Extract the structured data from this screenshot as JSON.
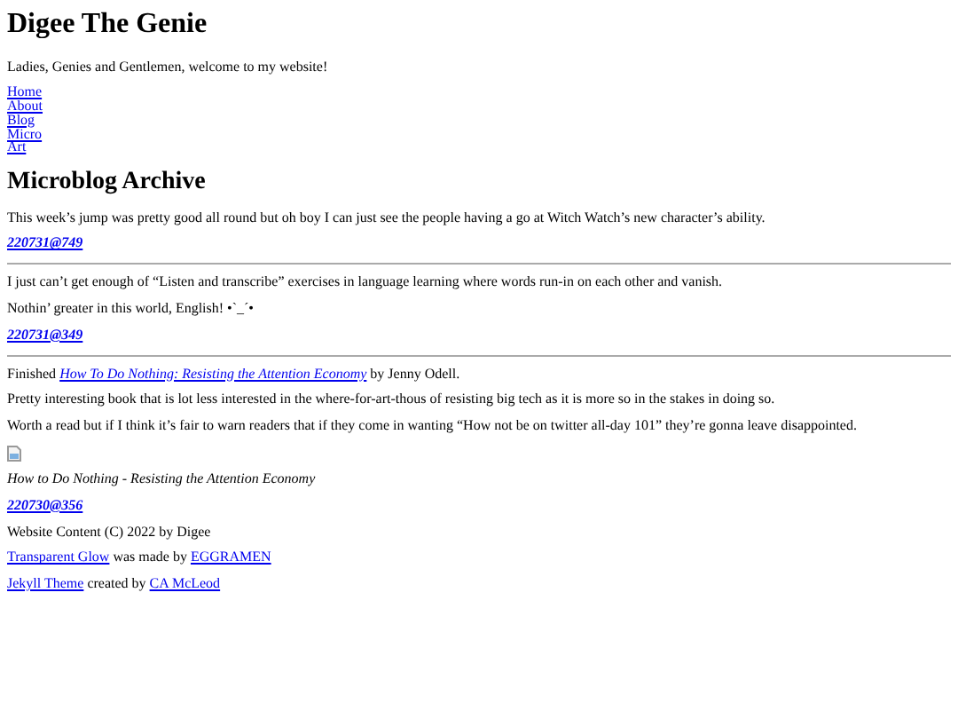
{
  "site_title": "Digee The Genie",
  "tagline": "Ladies, Genies and Gentlemen, welcome to my website!",
  "nav": [
    "Home",
    "About",
    "Blog",
    "Micro",
    "Art"
  ],
  "heading": "Microblog Archive",
  "posts": [
    {
      "blocks": [
        {
          "kind": "paragraph",
          "parts": [
            {
              "kind": "text",
              "text": "This week’s jump was pretty good all round but oh boy I can just see the people having a go at Witch Watch’s new character’s ability."
            }
          ]
        }
      ],
      "permalink": "220731@749"
    },
    {
      "blocks": [
        {
          "kind": "paragraph",
          "parts": [
            {
              "kind": "text",
              "text": "I just can’t get enough of “Listen and transcribe” exercises in language learning where words run-in on each other and vanish."
            }
          ]
        },
        {
          "kind": "paragraph",
          "parts": [
            {
              "kind": "text",
              "text": "Nothin’ greater in this world, English! •`_´•"
            }
          ]
        }
      ],
      "permalink": "220731@349"
    },
    {
      "blocks": [
        {
          "kind": "paragraph",
          "parts": [
            {
              "kind": "text",
              "text": "Finished "
            },
            {
              "kind": "book_link",
              "text": "How To Do Nothing: Resisting the Attention Economy"
            },
            {
              "kind": "text",
              "text": " by Jenny Odell."
            }
          ]
        },
        {
          "kind": "paragraph",
          "parts": [
            {
              "kind": "text",
              "text": "Pretty interesting book that is lot less interested in the where-for-art-thous of resisting big tech as it is more so in the stakes in doing so."
            }
          ]
        },
        {
          "kind": "paragraph",
          "parts": [
            {
              "kind": "text",
              "text": "Worth a read but if I think it’s fair to warn readers that if they come in wanting “How not be on twitter all-day 101” they’re gonna leave disappointed."
            }
          ]
        },
        {
          "kind": "image"
        },
        {
          "kind": "caption",
          "parts": [
            {
              "kind": "text",
              "text": "How to Do Nothing - Resisting the Attention Economy"
            }
          ]
        }
      ],
      "permalink": "220730@356"
    }
  ],
  "footer": [
    [
      {
        "kind": "text",
        "text": "Website Content (C) 2022 by Digee"
      }
    ],
    [
      {
        "kind": "link",
        "text": "Transparent Glow"
      },
      {
        "kind": "text",
        "text": " was made by "
      },
      {
        "kind": "link",
        "text": "EGGRAMEN"
      }
    ],
    [
      {
        "kind": "link",
        "text": "Jekyll Theme"
      },
      {
        "kind": "text",
        "text": " created by "
      },
      {
        "kind": "link",
        "text": "CA McLeod"
      }
    ]
  ]
}
